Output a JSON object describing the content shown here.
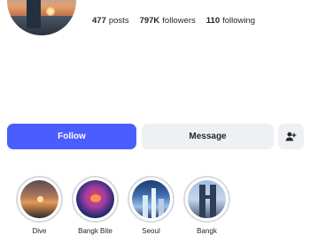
{
  "profile": {
    "stats": {
      "posts": {
        "value": "477",
        "label": "posts"
      },
      "followers": {
        "value": "797K",
        "label": "followers"
      },
      "following": {
        "value": "110",
        "label": "following"
      }
    }
  },
  "actions": {
    "follow_label": "Follow",
    "message_label": "Message",
    "add_user_icon": "add-user-icon"
  },
  "highlights": [
    {
      "label": "Dive"
    },
    {
      "label": "Bangk Bite"
    },
    {
      "label": "Seoul"
    },
    {
      "label": "Bangk"
    }
  ],
  "colors": {
    "accent": "#4a5dff",
    "secondary_button": "#eef0f3"
  }
}
